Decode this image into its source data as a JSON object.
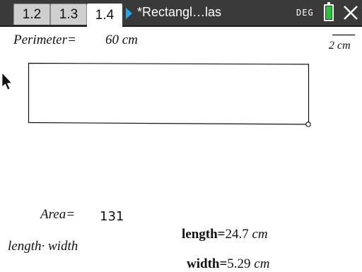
{
  "tabs": [
    "1.2",
    "1.3",
    "1.4"
  ],
  "active_tab": 2,
  "document_title": "*Rectangl…las",
  "angle_mode": "DEG",
  "battery_level": 1.0,
  "scale": {
    "label": "2 cm"
  },
  "perimeter": {
    "label": "Perimeter=",
    "value": "60 cm"
  },
  "area": {
    "label": "Area=",
    "value": "131"
  },
  "formula": "length· width",
  "length": {
    "label": "length=",
    "value": "24.7",
    "unit": "cm"
  },
  "width": {
    "label": "width=",
    "value": "5.29",
    "unit": "cm"
  }
}
